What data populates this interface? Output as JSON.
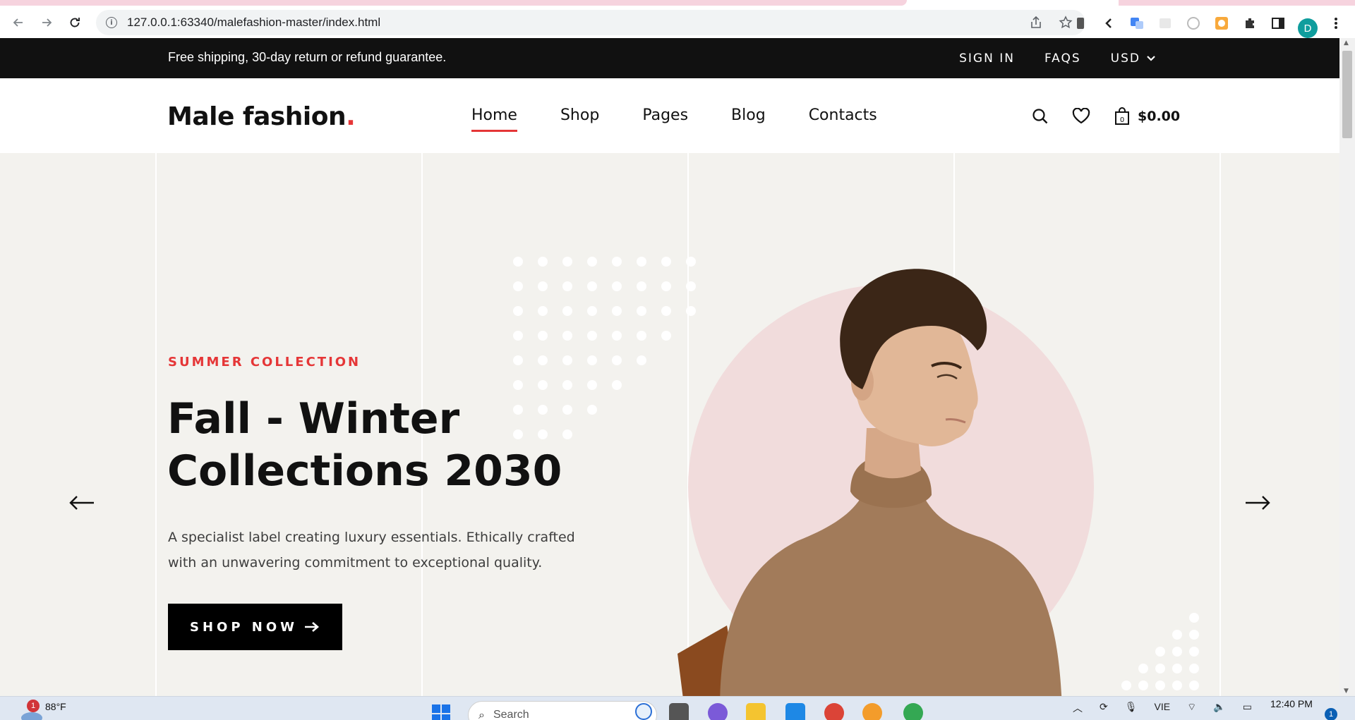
{
  "browser": {
    "url": "127.0.0.1:63340/malefashion-master/index.html",
    "avatar_letter": "D"
  },
  "topbar": {
    "notice": "Free shipping, 30-day return or refund guarantee.",
    "sign_in": "SIGN IN",
    "faqs": "FAQS",
    "currency": "USD"
  },
  "header": {
    "logo_text": "Male fashion",
    "logo_dot": ".",
    "nav": [
      {
        "label": "Home",
        "active": true
      },
      {
        "label": "Shop"
      },
      {
        "label": "Pages"
      },
      {
        "label": "Blog"
      },
      {
        "label": "Contacts"
      }
    ],
    "cart_count": "0",
    "cart_total": "$0.00"
  },
  "hero": {
    "eyebrow": "SUMMER COLLECTION",
    "headline_line1": "Fall - Winter",
    "headline_line2": "Collections 2030",
    "description": "A specialist label creating luxury essentials. Ethically crafted with an unwavering commitment to exceptional quality.",
    "button_label": "SHOP NOW",
    "accent_color": "#e53637"
  },
  "taskbar": {
    "weather_badge": "1",
    "weather_temp": "88°F",
    "search_label": "Search",
    "language": "VIE",
    "time": "12:40 PM",
    "notification_count": "1"
  }
}
